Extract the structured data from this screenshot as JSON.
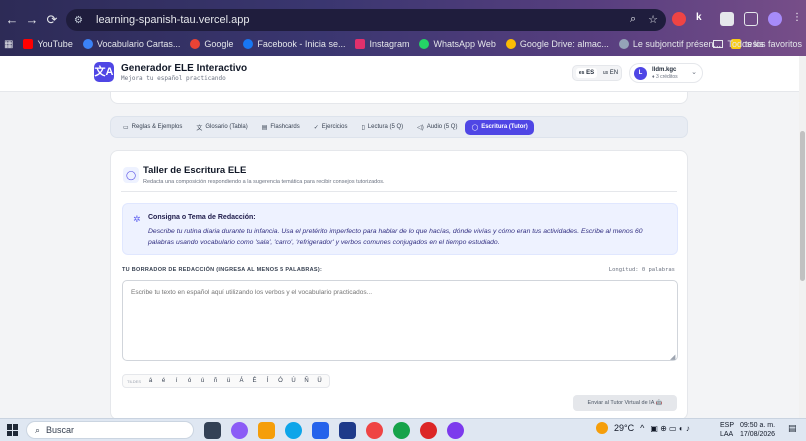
{
  "browser": {
    "url": "learning-spanish-tau.vercel.app",
    "bookmarks": [
      {
        "label": "YouTube",
        "color": "#ff0000"
      },
      {
        "label": "Vocabulario Cartas...",
        "color": "#3b82f6"
      },
      {
        "label": "Google",
        "color": "#ea4335"
      },
      {
        "label": "Facebook - Inicia se...",
        "color": "#1877f2"
      },
      {
        "label": "Instagram",
        "color": "#e1306c"
      },
      {
        "label": "WhatsApp Web",
        "color": "#25d366"
      },
      {
        "label": "Google Drive: almac...",
        "color": "#fbbc04"
      },
      {
        "label": "Le subjonctif présen...",
        "color": "#94a3b8"
      },
      {
        "label": "tesis",
        "color": "#facc15"
      }
    ],
    "bookmarks_right": "Todos los favoritos"
  },
  "header": {
    "logo_glyph": "文A",
    "title": "Generador ELE Interactivo",
    "subtitle": "Mejora tu español practicando",
    "lang_es": "ES",
    "lang_en": "EN",
    "avatar": "L",
    "user": "lldm.kgc",
    "credits": "♦ 3 créditos"
  },
  "tabs": [
    {
      "icon": "▭",
      "label": "Reglas & Ejemplos",
      "active": false
    },
    {
      "icon": "文",
      "label": "Glosario (Tabla)",
      "active": false
    },
    {
      "icon": "▤",
      "label": "Flashcards",
      "active": false
    },
    {
      "icon": "✓",
      "label": "Ejercicios",
      "active": false
    },
    {
      "icon": "▯",
      "label": "Lectura (5 Q)",
      "active": false
    },
    {
      "icon": "◁)",
      "label": "Audio (5 Q)",
      "active": false
    },
    {
      "icon": "◯",
      "label": "Escritura (Tutor)",
      "active": true
    }
  ],
  "card": {
    "title": "Taller de Escritura ELE",
    "subtitle": "Redacta una composición respondiendo a la sugerencia temática para recibir consejos tutorizados.",
    "prompt_title": "Consigna o Tema de Redacción:",
    "prompt_text": "Describe tu rutina diaria durante tu infancia. Usa el pretérito imperfecto para hablar de lo que hacías, dónde vivías y cómo eran tus actividades. Escribe al menos 60 palabras usando vocabulario como 'sala', 'carro', 'refrigerador' y verbos comunes conjugados en el tiempo estudiado.",
    "draft_label": "TU BORRADOR DE REDACCIÓN (INGRESA AL MENOS 5 PALABRAS):",
    "length_label": "Longitud: 0 palabras",
    "placeholder": "Escribe tu texto en español aquí utilizando los verbos y el vocabulario practicados...",
    "chars_label": "TILDES",
    "chars": [
      "á",
      "é",
      "í",
      "ó",
      "ú",
      "ñ",
      "ü",
      "Á",
      "É",
      "Í",
      "Ó",
      "Ú",
      "Ñ",
      "Ü"
    ],
    "send_button": "Enviar al Tutor Virtual de IA 🤖"
  },
  "taskbar": {
    "search_placeholder": "Buscar",
    "weather": "29°C",
    "lang": "ESP",
    "lang2": "LAA",
    "time": "09:50 a. m.",
    "date": "17/08/2026"
  },
  "colors": {
    "accent": "#4f46e5",
    "chrome": "#3a3670"
  }
}
